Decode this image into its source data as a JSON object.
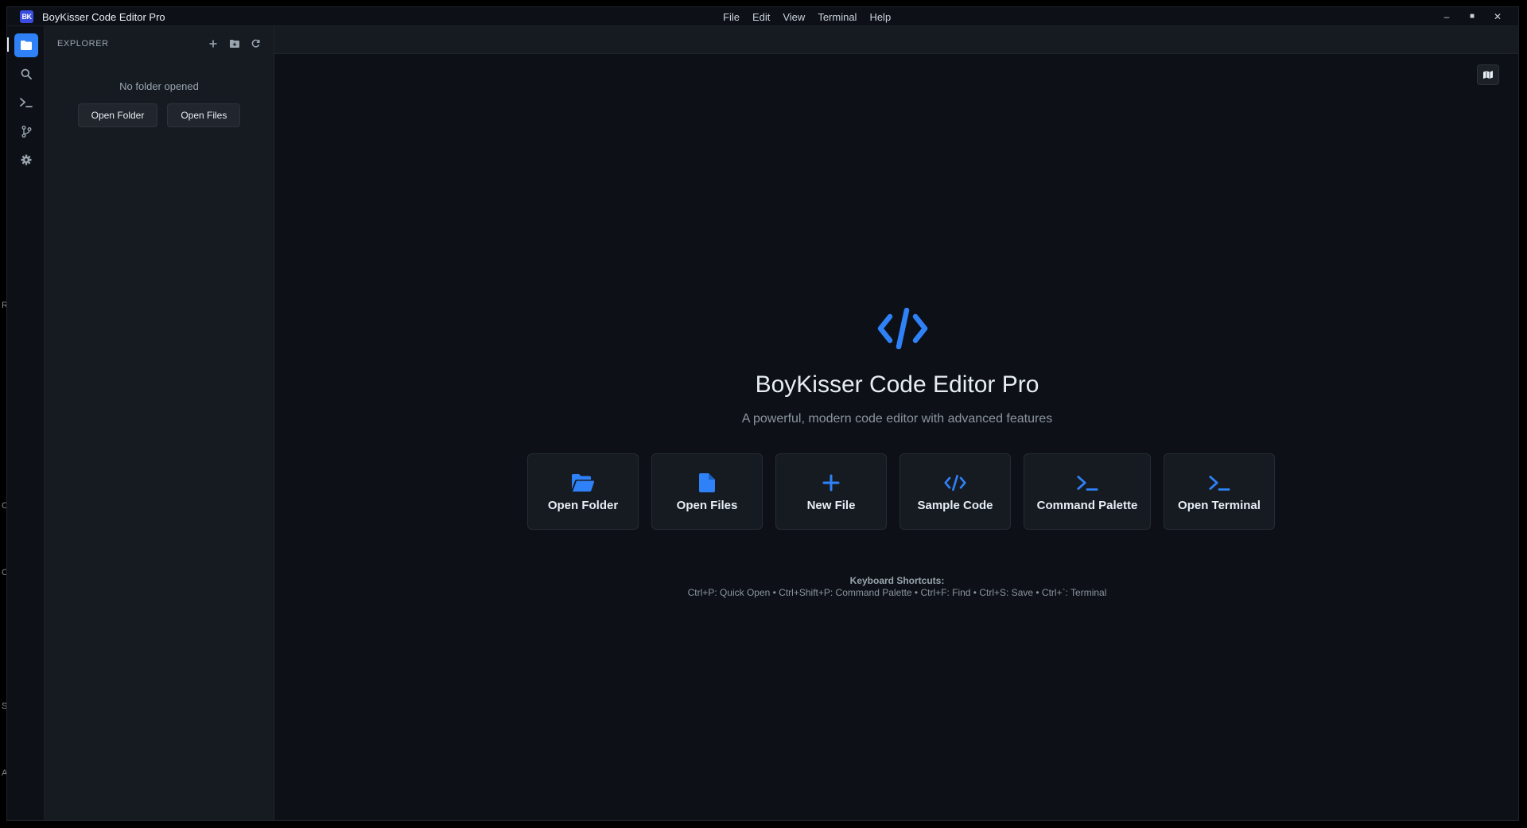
{
  "app": {
    "logo_text": "BK",
    "title": "BoyKisser Code Editor Pro"
  },
  "menu": [
    "File",
    "Edit",
    "View",
    "Terminal",
    "Help"
  ],
  "window_controls": {
    "minimize": "–",
    "maximize": "■",
    "close": "✕"
  },
  "activity_bar": [
    {
      "name": "explorer",
      "icon": "folder-icon",
      "active": true
    },
    {
      "name": "search",
      "icon": "search-icon",
      "active": false
    },
    {
      "name": "terminal",
      "icon": "terminal-icon",
      "active": false
    },
    {
      "name": "source-control",
      "icon": "git-branch-icon",
      "active": false
    },
    {
      "name": "settings",
      "icon": "gear-icon",
      "active": false
    }
  ],
  "sidebar": {
    "title": "EXPLORER",
    "actions": [
      "new-file-icon",
      "new-folder-icon",
      "refresh-icon"
    ],
    "empty_message": "No folder opened",
    "open_folder_label": "Open Folder",
    "open_files_label": "Open Files"
  },
  "welcome": {
    "title": "BoyKisser Code Editor Pro",
    "subtitle": "A powerful, modern code editor with advanced features",
    "cards": [
      {
        "label": "Open Folder",
        "icon": "folder-open-icon"
      },
      {
        "label": "Open Files",
        "icon": "file-icon"
      },
      {
        "label": "New File",
        "icon": "plus-icon"
      },
      {
        "label": "Sample Code",
        "icon": "code-icon"
      },
      {
        "label": "Command Palette",
        "icon": "terminal-icon"
      },
      {
        "label": "Open Terminal",
        "icon": "terminal-icon"
      }
    ],
    "shortcuts_title": "Keyboard Shortcuts:",
    "shortcuts_text": "Ctrl+P: Quick Open • Ctrl+Shift+P: Command Palette • Ctrl+F: Find • Ctrl+S: Save • Ctrl+`: Terminal"
  },
  "desktop_slivers": [
    "R",
    "C",
    "C",
    "S",
    "A"
  ],
  "colors": {
    "accent": "#2f81f7",
    "background": "#0d1117",
    "sidebar": "#161b22",
    "logo": "#3b4de0"
  }
}
